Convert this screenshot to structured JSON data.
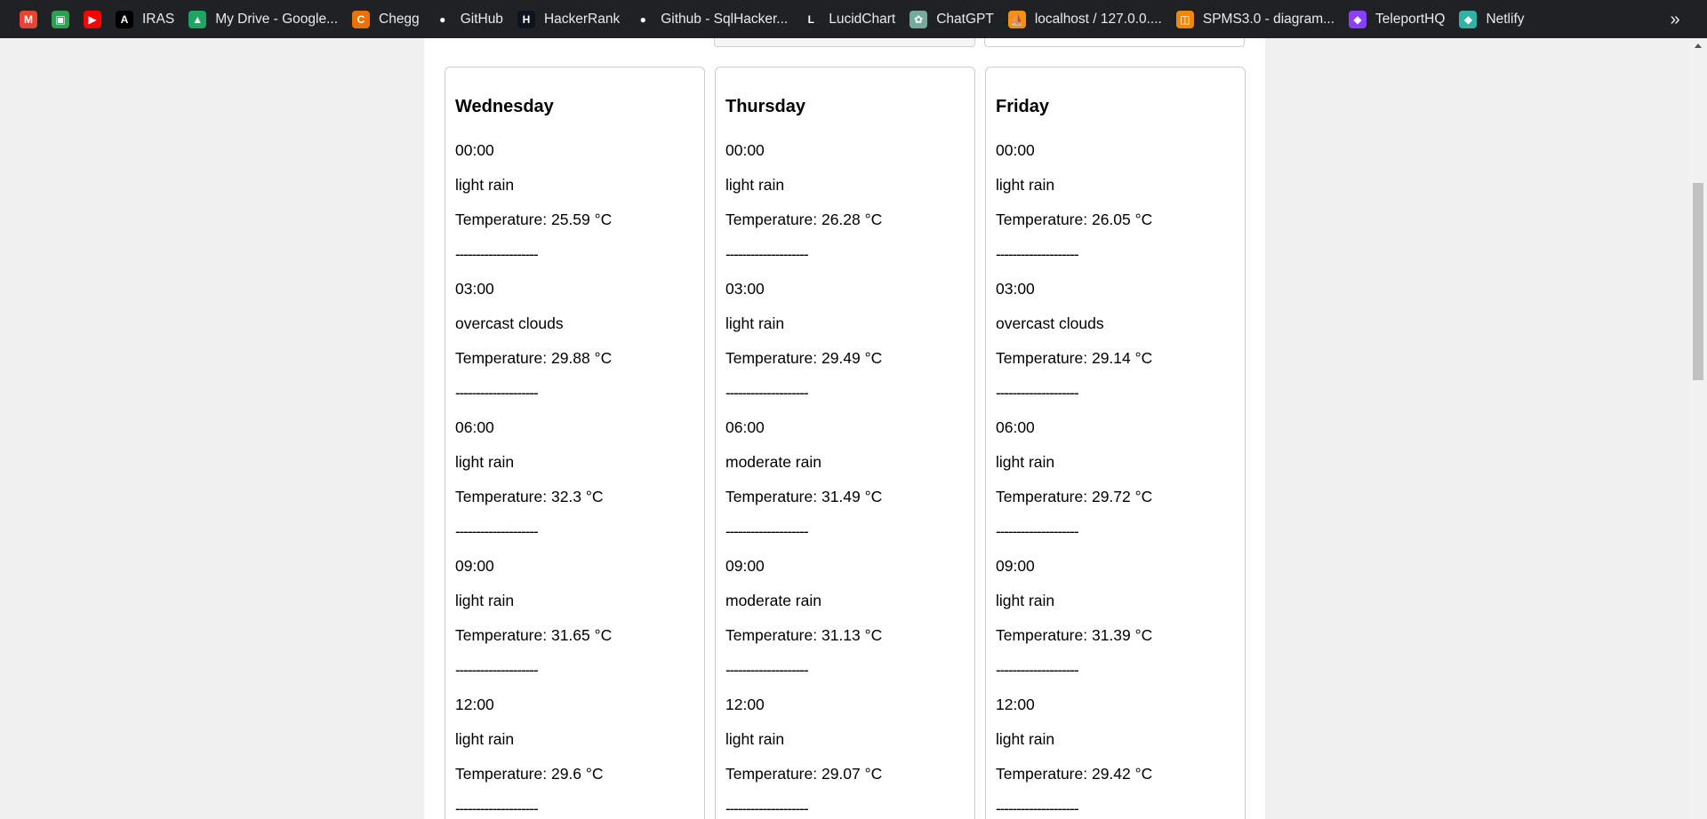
{
  "bookmarks": [
    {
      "name": "gmail",
      "label": "",
      "icon": "gmail-icon",
      "color": "#ea4335",
      "glyph": "M"
    },
    {
      "name": "classroom",
      "label": "",
      "icon": "classroom-icon",
      "color": "#2e9e4f",
      "glyph": "▣"
    },
    {
      "name": "youtube",
      "label": "",
      "icon": "youtube-icon",
      "color": "#ff0000",
      "glyph": "▶"
    },
    {
      "name": "iras",
      "label": "IRAS",
      "icon": "iras-icon",
      "color": "#000000",
      "glyph": "A"
    },
    {
      "name": "my-drive",
      "label": "My Drive - Google...",
      "icon": "drive-icon",
      "color": "#1fa463",
      "glyph": "▲"
    },
    {
      "name": "chegg",
      "label": "Chegg",
      "icon": "chegg-icon",
      "color": "#eb7100",
      "glyph": "C"
    },
    {
      "name": "github",
      "label": "GitHub",
      "icon": "github-icon",
      "color": "#202124",
      "glyph": "●"
    },
    {
      "name": "hackerrank",
      "label": "HackerRank",
      "icon": "hackerrank-icon",
      "color": "#0e141e",
      "glyph": "H"
    },
    {
      "name": "github-sqlhacker",
      "label": "Github - SqlHacker...",
      "icon": "github-icon",
      "color": "#202124",
      "glyph": "●"
    },
    {
      "name": "lucidchart",
      "label": "LucidChart",
      "icon": "lucidchart-icon",
      "color": "#202124",
      "glyph": "L"
    },
    {
      "name": "chatgpt",
      "label": "ChatGPT",
      "icon": "chatgpt-icon",
      "color": "#74aa9c",
      "glyph": "✿"
    },
    {
      "name": "localhost",
      "label": "localhost / 127.0.0....",
      "icon": "phpmyadmin-icon",
      "color": "#f29111",
      "glyph": "⛵"
    },
    {
      "name": "spms",
      "label": "SPMS3.0 - diagram...",
      "icon": "drawio-icon",
      "color": "#f08705",
      "glyph": "◫"
    },
    {
      "name": "teleporthq",
      "label": "TeleportHQ",
      "icon": "teleporthq-icon",
      "color": "#8a3ffc",
      "glyph": "◆"
    },
    {
      "name": "netlify",
      "label": "Netlify",
      "icon": "netlify-icon",
      "color": "#32b2a5",
      "glyph": "◆"
    }
  ],
  "more_glyph": "»",
  "days": [
    {
      "title": "Wednesday",
      "slots": [
        {
          "time": "00:00",
          "desc": "light rain",
          "temp": "Temperature: 25.59 °C"
        },
        {
          "time": "03:00",
          "desc": "overcast clouds",
          "temp": "Temperature: 29.88 °C"
        },
        {
          "time": "06:00",
          "desc": "light rain",
          "temp": "Temperature: 32.3 °C"
        },
        {
          "time": "09:00",
          "desc": "light rain",
          "temp": "Temperature: 31.65 °C"
        },
        {
          "time": "12:00",
          "desc": "light rain",
          "temp": "Temperature: 29.6 °C"
        }
      ]
    },
    {
      "title": "Thursday",
      "slots": [
        {
          "time": "00:00",
          "desc": "light rain",
          "temp": "Temperature: 26.28 °C"
        },
        {
          "time": "03:00",
          "desc": "light rain",
          "temp": "Temperature: 29.49 °C"
        },
        {
          "time": "06:00",
          "desc": "moderate rain",
          "temp": "Temperature: 31.49 °C"
        },
        {
          "time": "09:00",
          "desc": "moderate rain",
          "temp": "Temperature: 31.13 °C"
        },
        {
          "time": "12:00",
          "desc": "light rain",
          "temp": "Temperature: 29.07 °C"
        }
      ]
    },
    {
      "title": "Friday",
      "slots": [
        {
          "time": "00:00",
          "desc": "light rain",
          "temp": "Temperature: 26.05 °C"
        },
        {
          "time": "03:00",
          "desc": "overcast clouds",
          "temp": "Temperature: 29.14 °C"
        },
        {
          "time": "06:00",
          "desc": "light rain",
          "temp": "Temperature: 29.72 °C"
        },
        {
          "time": "09:00",
          "desc": "light rain",
          "temp": "Temperature: 31.39 °C"
        },
        {
          "time": "12:00",
          "desc": "light rain",
          "temp": "Temperature: 29.42 °C"
        }
      ]
    }
  ],
  "separator": "--------------------"
}
